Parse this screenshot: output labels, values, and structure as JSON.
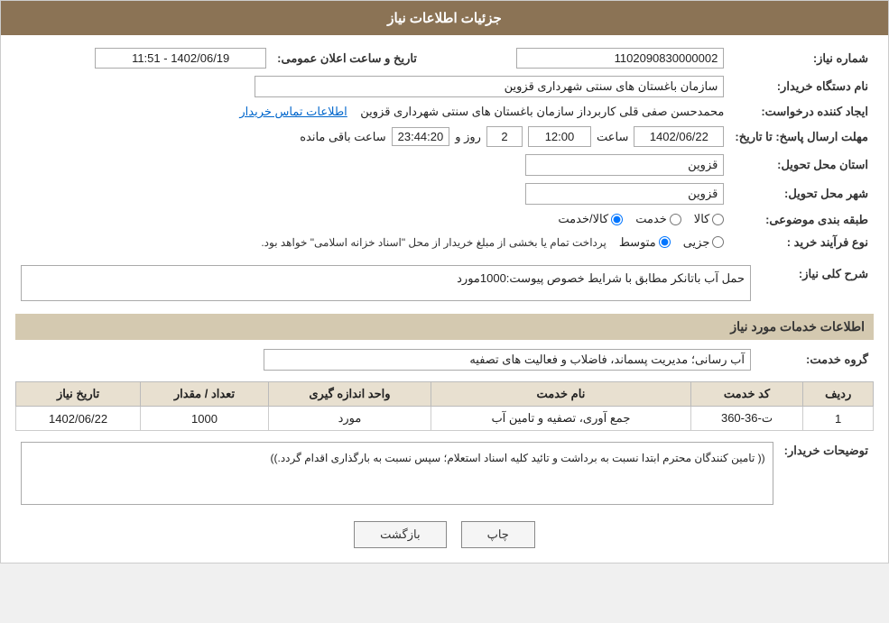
{
  "header": {
    "title": "جزئیات اطلاعات نیاز"
  },
  "fields": {
    "need_number_label": "شماره نیاز:",
    "need_number_value": "1102090830000002",
    "org_label": "نام دستگاه خریدار:",
    "org_value": "سازمان باغستان های سنتی شهرداری قزوین",
    "creator_label": "ایجاد کننده درخواست:",
    "creator_value": "محمدحسن صفی قلی کاربرداز سازمان باغستان های سنتی شهرداری قزوین",
    "contact_link": "اطلاعات تماس خریدار",
    "deadline_label": "مهلت ارسال پاسخ: تا تاریخ:",
    "deadline_date": "1402/06/22",
    "deadline_time": "12:00",
    "deadline_days": "2",
    "deadline_remaining": "23:44:20",
    "deadline_days_label": "روز و",
    "deadline_remaining_label": "ساعت باقی مانده",
    "province_label": "استان محل تحویل:",
    "province_value": "قزوین",
    "city_label": "شهر محل تحویل:",
    "city_value": "قزوین",
    "category_label": "طبقه بندی موضوعی:",
    "category_kala": "کالا",
    "category_khadamat": "خدمت",
    "category_kala_khadamat": "کالا/خدمت",
    "process_label": "نوع فرآیند خرید :",
    "process_jozi": "جزیی",
    "process_motavaset": "متوسط",
    "process_note": "پرداخت تمام یا بخشی از مبلغ خریدار از محل \"اسناد خزانه اسلامی\" خواهد بود.",
    "announcement_label": "تاریخ و ساعت اعلان عمومی:",
    "announcement_value": "1402/06/19 - 11:51"
  },
  "need_description": {
    "section_title": "شرح کلی نیاز:",
    "value": "حمل آب باتانکر مطابق با شرایط خصوص پیوست:1000مورد"
  },
  "services_section": {
    "title": "اطلاعات خدمات مورد نیاز",
    "service_group_label": "گروه خدمت:",
    "service_group_value": "آب رسانی؛ مدیریت پسماند، فاضلاب و فعالیت های تصفیه"
  },
  "table": {
    "columns": [
      "ردیف",
      "کد خدمت",
      "نام خدمت",
      "واحد اندازه گیری",
      "تعداد / مقدار",
      "تاریخ نیاز"
    ],
    "rows": [
      {
        "row": "1",
        "code": "ت-36-360",
        "name": "جمع آوری، تصفیه و تامین آب",
        "unit": "مورد",
        "quantity": "1000",
        "date": "1402/06/22"
      }
    ]
  },
  "buyer_description": {
    "section_label": "توضیحات خریدار:",
    "value": "(( تامین کنندگان محترم ابتدا نسبت به برداشت و تائید کلیه اسناد استعلام؛ سپس نسبت به بارگذاری اقدام گردد.))"
  },
  "buttons": {
    "print": "چاپ",
    "back": "بازگشت"
  }
}
